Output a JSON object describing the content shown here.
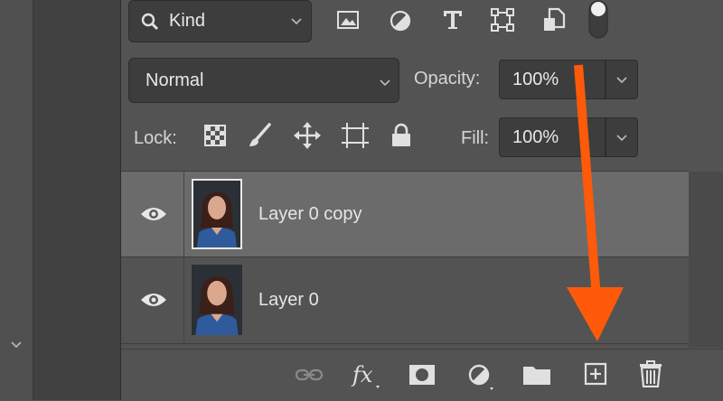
{
  "filter": {
    "kind_label": "Kind"
  },
  "blend": {
    "mode": "Normal",
    "opacity_label": "Opacity:",
    "opacity_value": "100%"
  },
  "lock": {
    "label": "Lock:",
    "fill_label": "Fill:",
    "fill_value": "100%"
  },
  "layers": [
    {
      "name": "Layer 0 copy",
      "selected": true
    },
    {
      "name": "Layer 0",
      "selected": false
    }
  ],
  "icons": {
    "filter": [
      "search-icon",
      "image-filter-icon",
      "adjustment-filter-icon",
      "type-filter-icon",
      "shape-filter-icon",
      "smart-object-filter-icon",
      "filter-toggle-icon"
    ],
    "lock": [
      "lock-transparent-pixels-icon",
      "lock-image-pixels-icon",
      "lock-position-icon",
      "lock-artboard-icon",
      "lock-all-icon"
    ],
    "bottom": [
      "link-layers-icon",
      "fx-icon",
      "layer-mask-icon",
      "adjustment-layer-icon",
      "group-folder-icon",
      "new-layer-icon",
      "trash-icon"
    ]
  },
  "colors": {
    "panel": "#535353",
    "selected_row": "#6b6b6b",
    "annotation_arrow": "#ff5a0a"
  }
}
